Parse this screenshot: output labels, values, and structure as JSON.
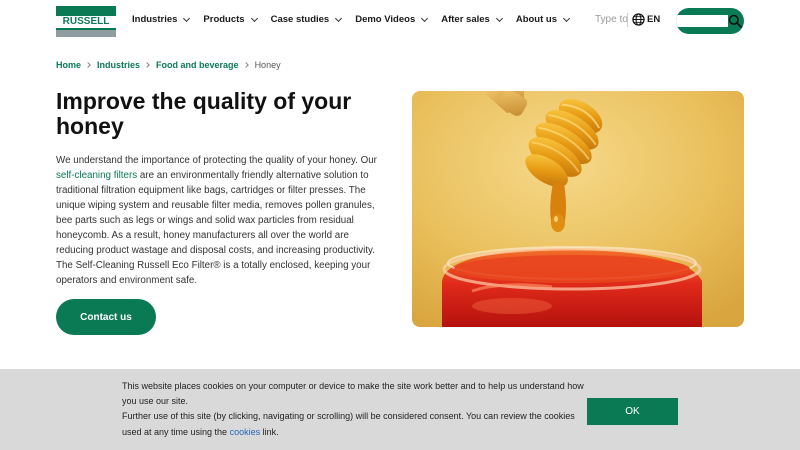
{
  "brand": {
    "logo_text": "RUSSELL"
  },
  "nav": {
    "items": [
      {
        "label": "Industries"
      },
      {
        "label": "Products"
      },
      {
        "label": "Case studies"
      },
      {
        "label": "Demo Videos"
      },
      {
        "label": "After sales"
      },
      {
        "label": "About us"
      }
    ]
  },
  "search": {
    "hint": "Type to"
  },
  "language": {
    "code": "EN"
  },
  "breadcrumb": {
    "items": [
      "Home",
      "Industries",
      "Food and beverage"
    ],
    "current": "Honey"
  },
  "page": {
    "title": "Improve the quality of your honey",
    "body_before_link": "We understand the importance of protecting the quality of your honey. Our ",
    "body_link": "self-cleaning filters",
    "body_after_link": " are an environmentally friendly alternative solution to traditional filtration equipment like bags, cartridges or filter presses. The unique wiping system and reusable filter media, removes pollen granules, bee parts such as legs or wings and solid wax particles from residual honeycomb. As a result, honey manufacturers all over the world are reducing product wastage and disposal costs, and increasing productivity. The Self-Cleaning Russell Eco Filter® is a totally enclosed, keeping your operators and environment safe.",
    "contact_label": "Contact us"
  },
  "cookie": {
    "line1": "This website places cookies on your computer or device to make the site work better and to help us understand how you use our site.",
    "line2_before_link": "Further use of this site (by clicking, navigating or scrolling) will be considered consent. You can review the cookies used at any time using the ",
    "line2_link": "cookies",
    "line2_after_link": " link.",
    "ok_label": "OK"
  },
  "colors": {
    "brand_green": "#0a7a55",
    "link_blue": "#2566b8",
    "cookie_bg": "#d9d9d9"
  }
}
